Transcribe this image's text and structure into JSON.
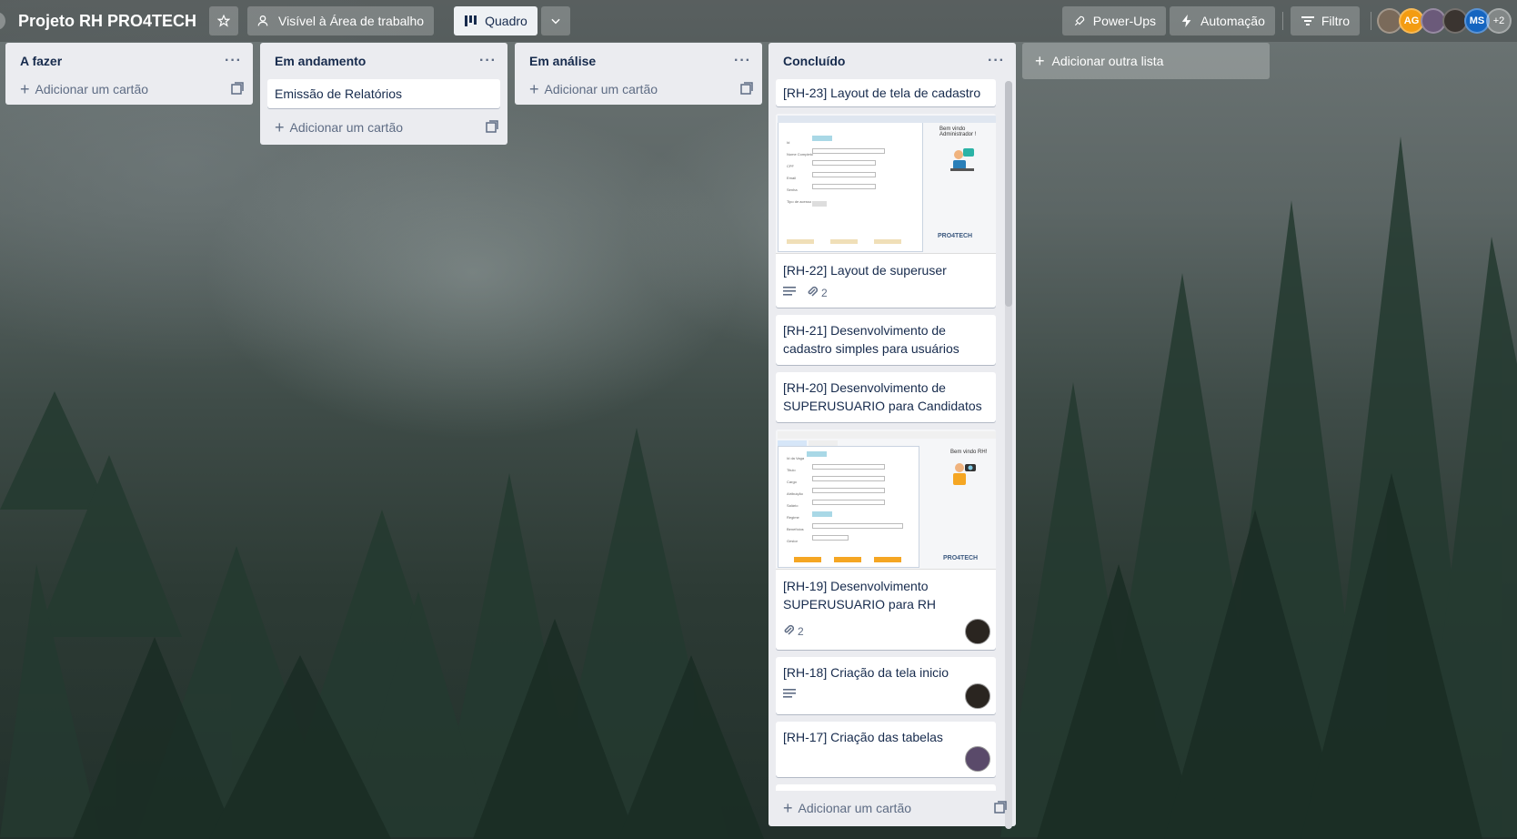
{
  "header": {
    "board_title": "Projeto RH PRO4TECH",
    "visibility_label": "Visível à Área de trabalho",
    "view_label": "Quadro",
    "powerups_label": "Power-Ups",
    "automation_label": "Automação",
    "filter_label": "Filtro",
    "members": [
      {
        "initials": "",
        "color": "#7a6a5a",
        "icon": "member-photo"
      },
      {
        "initials": "AG",
        "color": "#f39c12"
      },
      {
        "initials": "",
        "color": "#6b5a7a",
        "icon": "member-photo"
      },
      {
        "initials": "",
        "color": "#3a3430",
        "icon": "member-photo"
      },
      {
        "initials": "MS",
        "color": "#1565c0"
      }
    ],
    "more_members": "+2"
  },
  "lists": [
    {
      "title": "A fazer",
      "cards": [],
      "add_label": "Adicionar um cartão"
    },
    {
      "title": "Em andamento",
      "cards": [
        {
          "text": "Emissão de Relatórios"
        }
      ],
      "add_label": "Adicionar um cartão"
    },
    {
      "title": "Em análise",
      "cards": [],
      "add_label": "Adicionar um cartão"
    },
    {
      "title": "Concluído",
      "add_label": "Adicionar um cartão",
      "cards": [
        {
          "text": "[RH-23] Layout de tela de cadastro"
        },
        {
          "text": "[RH-22] Layout de superuser",
          "has_cover": true,
          "has_description": true,
          "attachments": "2",
          "cover": {
            "greeting": "Bem vindo Administrador !",
            "brand": "PRO4TECH",
            "field_labels": [
              "Id",
              "Nome Completo",
              "CPF",
              "Email",
              "Senha",
              "Tipo de acesso"
            ]
          }
        },
        {
          "text": "[RH-21] Desenvolvimento de cadastro simples para usuários"
        },
        {
          "text": "[RH-20] Desenvolvimento de SUPERUSUARIO para Candidatos"
        },
        {
          "text": "[RH-19] Desenvolvimento SUPERUSUARIO para RH",
          "has_cover": true,
          "attachments": "2",
          "has_member": true,
          "cover": {
            "greeting": "Bem vindo RH!",
            "brand": "PRO4TECH",
            "field_labels": [
              "Id da Vaga",
              "Titulo",
              "Cargo",
              "Atribuição",
              "Salário",
              "Regime",
              "Benefícios",
              "Gestor"
            ]
          }
        },
        {
          "text": "[RH-18] Criação da tela inicio",
          "has_description": true,
          "has_member": true
        },
        {
          "text": "[RH-17] Criação das tabelas",
          "has_member": true
        }
      ]
    }
  ],
  "add_list_label": "Adicionar outra lista"
}
